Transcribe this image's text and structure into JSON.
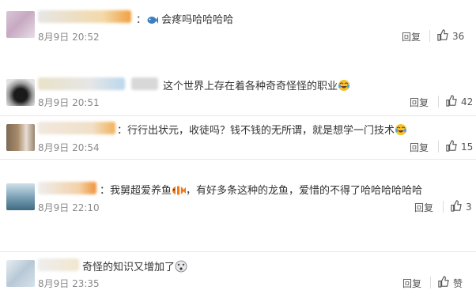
{
  "comments": [
    {
      "text": "会疼吗哈哈哈哈",
      "time": "8月9日 20:52",
      "reply": "回复",
      "likes": "36",
      "emoji_prefix": "fish-icon"
    },
    {
      "text": "这个世界上存在着各种奇奇怪怪的职业",
      "time": "8月9日 20:51",
      "reply": "回复",
      "likes": "42",
      "emoji_suffix": "laugh-cry-icon"
    },
    {
      "text": "：行行出状元，收徒吗？钱不钱的无所谓，就是想学一门技术",
      "time": "8月9日 20:54",
      "reply": "回复",
      "likes": "15",
      "emoji_suffix": "laugh-cry-icon"
    },
    {
      "text_a": "：我舅超爱养鱼",
      "text_b": "，有好多条这种的龙鱼，爱惜的不得了哈哈哈哈哈哈",
      "time": "8月9日 22:10",
      "reply": "回复",
      "likes": "3",
      "emoji_mid": "clownfish-icon"
    },
    {
      "text": "奇怪的知识又增加了",
      "time": "8月9日 23:35",
      "reply": "回复",
      "likes": "赞",
      "emoji_suffix": "dizzy-face-icon"
    }
  ],
  "colors": {
    "text": "#333333",
    "time": "#8a8a8a",
    "border": "#e8e8e8"
  }
}
